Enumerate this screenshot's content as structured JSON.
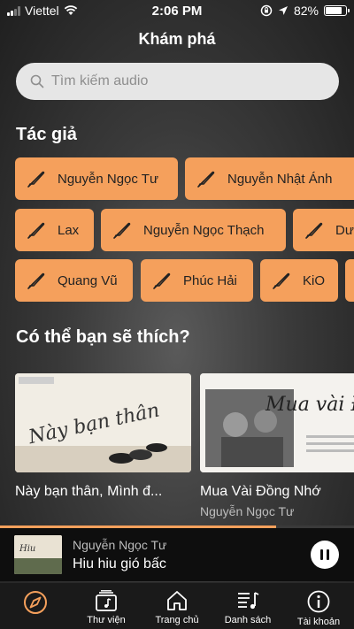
{
  "status_bar": {
    "carrier": "Viettel",
    "time": "2:06 PM",
    "battery": "82%"
  },
  "header": {
    "title": "Khám phá"
  },
  "search": {
    "placeholder": "Tìm kiếm audio",
    "icon": "search-icon"
  },
  "authors_section": {
    "title": "Tác giả",
    "rows": [
      [
        "Nguyễn Ngọc Tư",
        "Nguyễn Nhật Ánh"
      ],
      [
        "Lax",
        "Nguyễn Ngọc Thạch",
        "Dư"
      ],
      [
        "Quang Vũ",
        "Phúc Hải",
        "KiO"
      ]
    ]
  },
  "recommend_section": {
    "title": "Có thể bạn sẽ thích?",
    "cards": [
      {
        "title": "Này bạn thân, Mình đ...",
        "author": "",
        "thumb_text": "Này bạn thân"
      },
      {
        "title": "Mua Vài Đồng Nhớ",
        "author": "Nguyễn Ngọc Tư",
        "thumb_text": "Mua vài Đồng nh"
      }
    ]
  },
  "now_playing": {
    "author": "Nguyễn Ngọc Tư",
    "title": "Hiu hiu gió bấc",
    "progress": 0.78
  },
  "tabs": [
    {
      "label": "",
      "icon": "compass-icon",
      "active": true
    },
    {
      "label": "Thư viện",
      "icon": "music-library-icon"
    },
    {
      "label": "Trang chủ",
      "icon": "home-icon"
    },
    {
      "label": "Danh sách",
      "icon": "playlist-icon"
    },
    {
      "label": "Tài khoản",
      "icon": "info-icon"
    }
  ],
  "colors": {
    "accent": "#f5a05c",
    "chip_text": "#222222"
  }
}
